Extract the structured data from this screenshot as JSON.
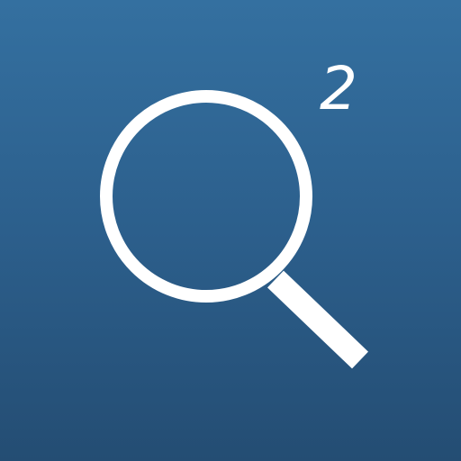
{
  "icon": {
    "name": "magnifier-icon",
    "superscript": "2",
    "colors": {
      "background_top": "#3470a0",
      "background_bottom": "#244d73",
      "foreground": "#ffffff"
    }
  }
}
